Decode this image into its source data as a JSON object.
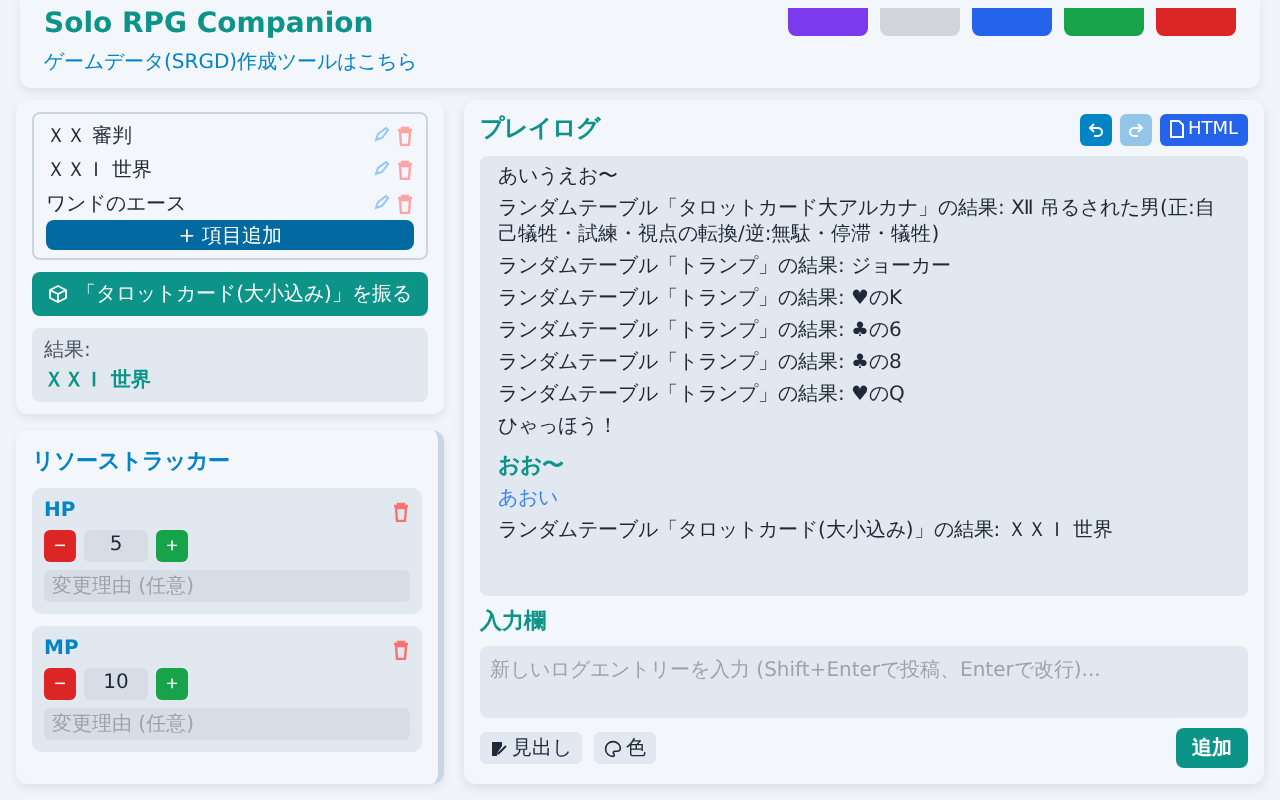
{
  "header": {
    "title": "Solo RPG Companion",
    "link": "ゲームデータ(SRGD)作成ツールはこちら",
    "buttons": [
      {
        "color": "#7c3aed"
      },
      {
        "color": "#d1d5db"
      },
      {
        "color": "#2563eb"
      },
      {
        "color": "#16a34a"
      },
      {
        "color": "#dc2626"
      }
    ]
  },
  "table_editor": {
    "items": [
      "ＸＸ 審判",
      "ＸＸＩ 世界",
      "ワンドのエース"
    ],
    "add_button": "+ 項目追加"
  },
  "roll_button": "「タロットカード(大小込み)」を振る",
  "result": {
    "label": "結果:",
    "value": "ＸＸＩ 世界"
  },
  "resource_tracker": {
    "title": "リソーストラッカー",
    "resources": [
      {
        "name": "HP",
        "value": "5",
        "minus": "−",
        "plus": "+",
        "reason_placeholder": "変更理由 (任意)"
      },
      {
        "name": "MP",
        "value": "10",
        "minus": "−",
        "plus": "+",
        "reason_placeholder": "変更理由 (任意)"
      }
    ]
  },
  "play_log": {
    "title": "プレイログ",
    "undo_disabled": false,
    "redo_disabled": true,
    "export_button": "HTML",
    "entries": [
      {
        "kind": "text",
        "text": "あいうえお〜"
      },
      {
        "kind": "text",
        "text": "ランダムテーブル「タロットカード大アルカナ」の結果: Ⅻ 吊るされた男(正:自己犠牲・試練・視点の転換/逆:無駄・停滞・犠牲)"
      },
      {
        "kind": "text",
        "text": "ランダムテーブル「トランプ」の結果: ジョーカー"
      },
      {
        "kind": "text",
        "text": "ランダムテーブル「トランプ」の結果: ♥のK"
      },
      {
        "kind": "text",
        "text": "ランダムテーブル「トランプ」の結果: ♣の6"
      },
      {
        "kind": "text",
        "text": "ランダムテーブル「トランプ」の結果: ♣の8"
      },
      {
        "kind": "text",
        "text": "ランダムテーブル「トランプ」の結果: ♥のQ"
      },
      {
        "kind": "text",
        "text": "ひゃっほう！"
      },
      {
        "kind": "heading",
        "text": "おお〜"
      },
      {
        "kind": "colored",
        "text": "あおい",
        "color": "#3b82f6"
      },
      {
        "kind": "text",
        "text": "ランダムテーブル「タロットカード(大小込み)」の結果: ＸＸＩ 世界"
      }
    ]
  },
  "input": {
    "title": "入力欄",
    "placeholder": "新しいログエントリーを入力 (Shift+Enterで投稿、Enterで改行)...",
    "heading_button": "見出し",
    "color_button": "色",
    "add_button": "追加"
  }
}
